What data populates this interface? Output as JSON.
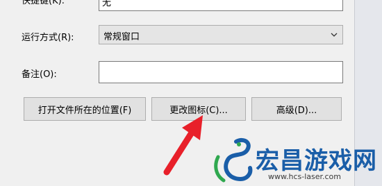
{
  "dialog": {
    "shortcut_key_label": "快捷键(K):",
    "shortcut_key_value": "无",
    "run_label": "运行方式(R):",
    "run_value": "常规窗口",
    "comment_label": "备注(O):",
    "comment_value": "",
    "buttons": {
      "open_location": "打开文件所在的位置(F)",
      "change_icon": "更改图标(C)...",
      "advanced": "高级(D)..."
    }
  },
  "watermark": {
    "title": "宏昌游戏网",
    "url": "www.hcs-laser.com"
  },
  "colors": {
    "arrow": "#e8202a",
    "watermark_blue": "#1a5ea8",
    "watermark_green": "#2fa84f"
  }
}
